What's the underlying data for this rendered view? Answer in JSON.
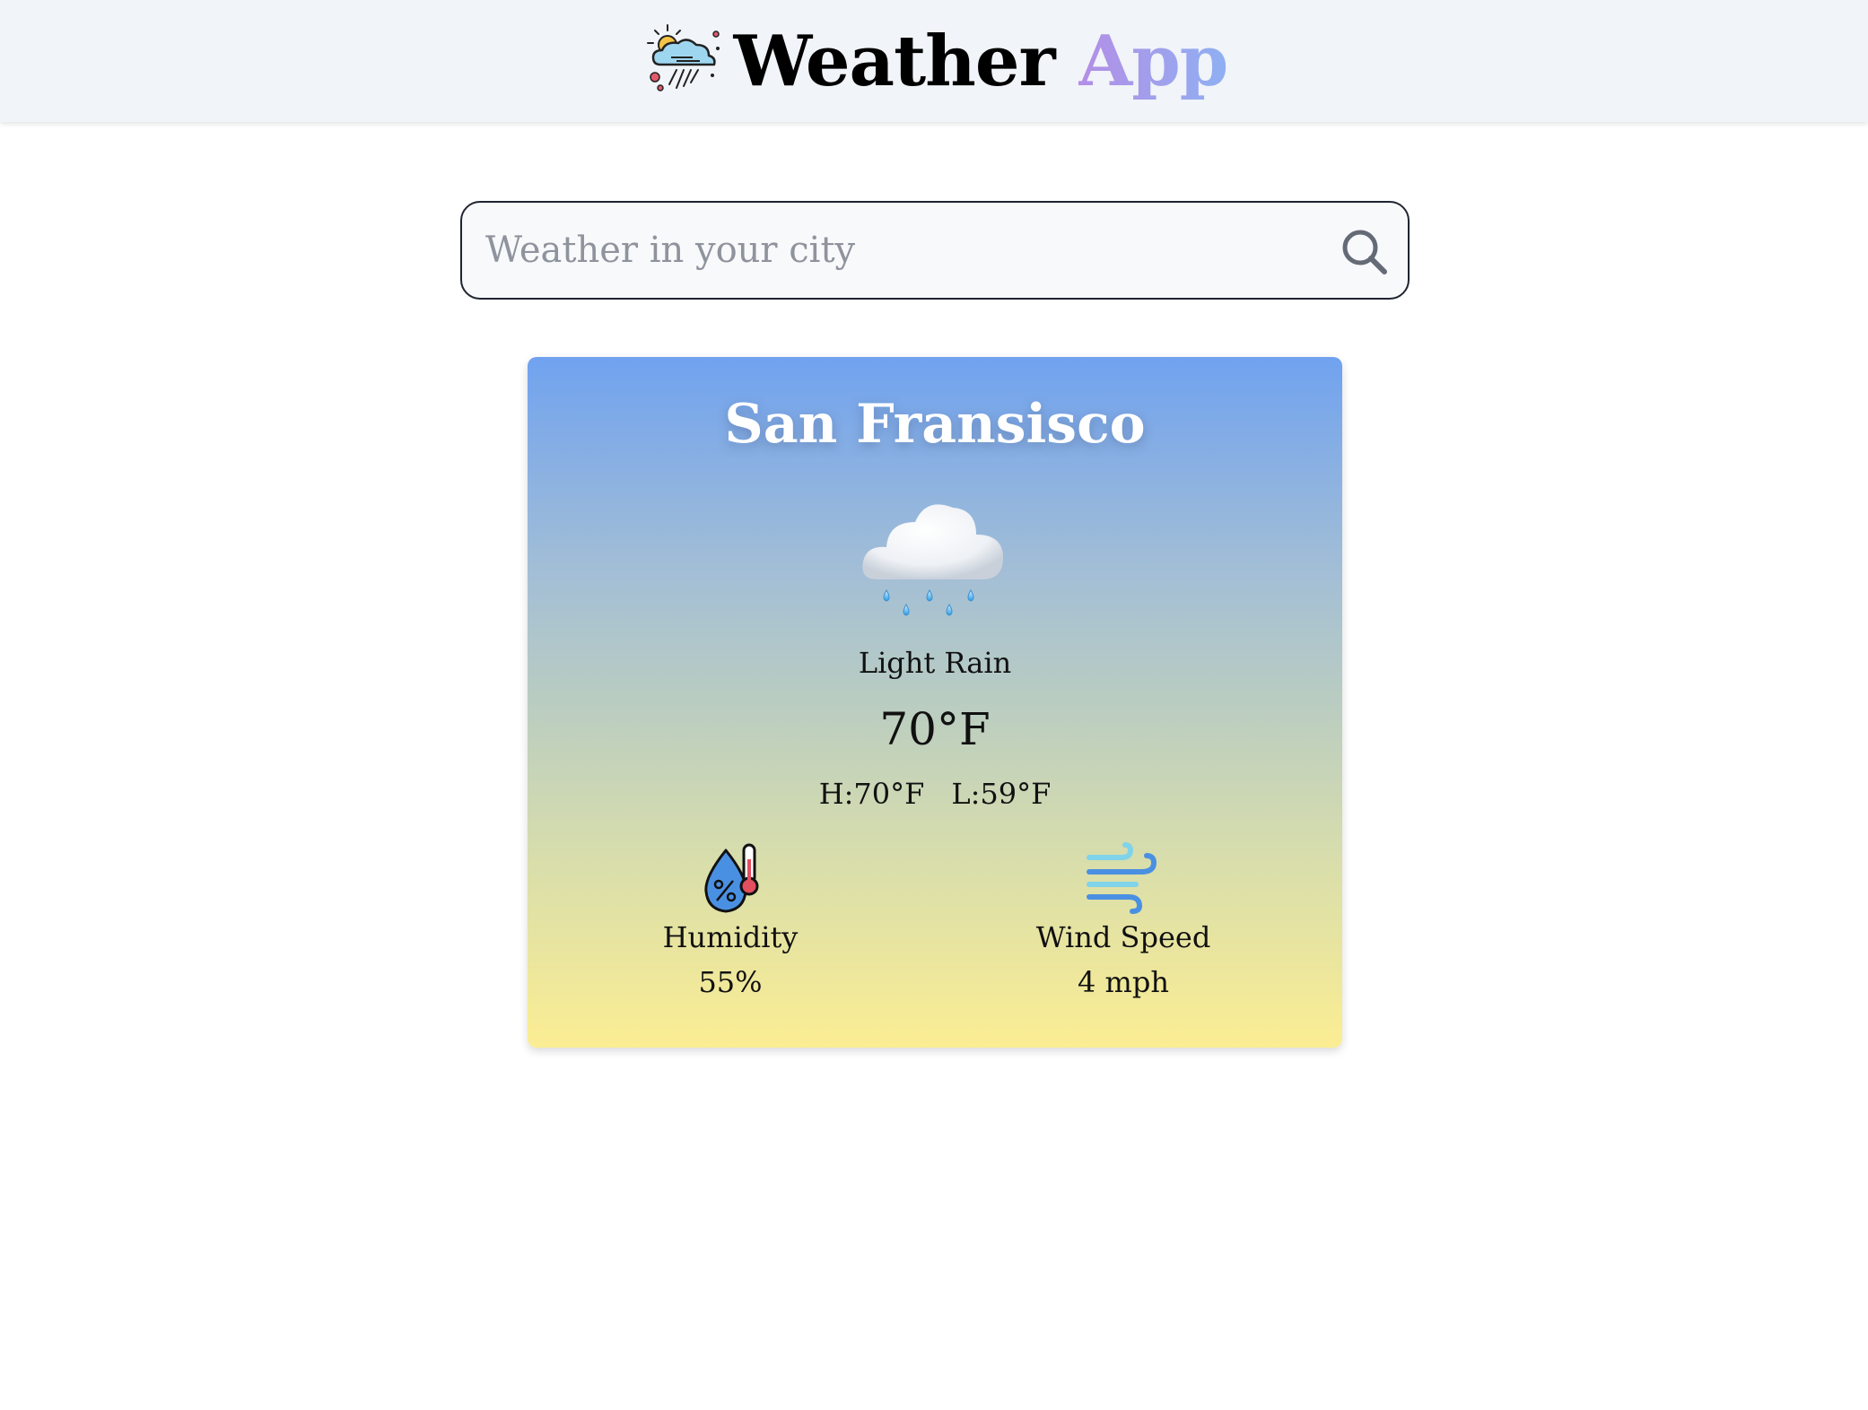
{
  "header": {
    "logo_icon": "weather-cloud-sun-rain-icon",
    "title_main": "Weather",
    "title_accent": "App"
  },
  "search": {
    "placeholder": "Weather in your city",
    "value": "",
    "icon": "search-icon"
  },
  "weather": {
    "city": "San Fransisco",
    "icon": "cloud-rain-icon",
    "condition": "Light Rain",
    "temperature": "70°F",
    "high": "H:70°F",
    "low": "L:59°F"
  },
  "stats": {
    "humidity": {
      "icon": "humidity-drop-thermometer-icon",
      "label": "Humidity",
      "value": "55%"
    },
    "wind": {
      "icon": "wind-icon",
      "label": "Wind Speed",
      "value": "4 mph"
    }
  },
  "colors": {
    "header_bg": "#f1f4f8",
    "accent_gradient_start": "#b48ee6",
    "accent_gradient_end": "#8fb0f2",
    "card_gradient_top": "#70a2ef",
    "card_gradient_bottom": "#fbed93"
  }
}
